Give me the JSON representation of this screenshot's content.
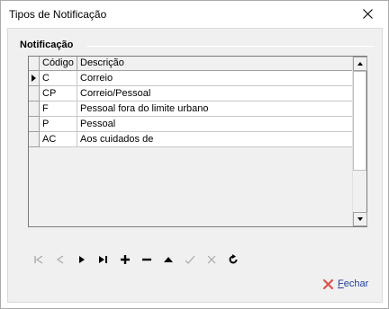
{
  "window": {
    "title": "Tipos de Notificação"
  },
  "group": {
    "title": "Notificação"
  },
  "grid": {
    "columns": [
      "Código",
      "Descrição"
    ],
    "rows": [
      {
        "code": "C",
        "description": "Correio",
        "current": true
      },
      {
        "code": "CP",
        "description": "Correio/Pessoal",
        "current": false
      },
      {
        "code": "F",
        "description": "Pessoal fora do limite urbano",
        "current": false
      },
      {
        "code": "P",
        "description": "Pessoal",
        "current": false
      },
      {
        "code": "AC",
        "description": "Aos cuidados de",
        "current": false
      }
    ]
  },
  "navigator": {
    "buttons": [
      {
        "name": "first-record-icon",
        "enabled": false
      },
      {
        "name": "prior-record-icon",
        "enabled": false
      },
      {
        "name": "next-record-icon",
        "enabled": true
      },
      {
        "name": "last-record-icon",
        "enabled": true
      },
      {
        "name": "insert-record-icon",
        "enabled": true
      },
      {
        "name": "delete-record-icon",
        "enabled": true
      },
      {
        "name": "edit-record-icon",
        "enabled": true
      },
      {
        "name": "post-record-icon",
        "enabled": false
      },
      {
        "name": "cancel-record-icon",
        "enabled": false
      },
      {
        "name": "refresh-icon",
        "enabled": true
      }
    ]
  },
  "footer": {
    "close_first": "F",
    "close_rest": "echar"
  },
  "colors": {
    "link": "#1f3f9c",
    "close_icon": "#d9534f",
    "disabled": "#a8a8a8"
  }
}
